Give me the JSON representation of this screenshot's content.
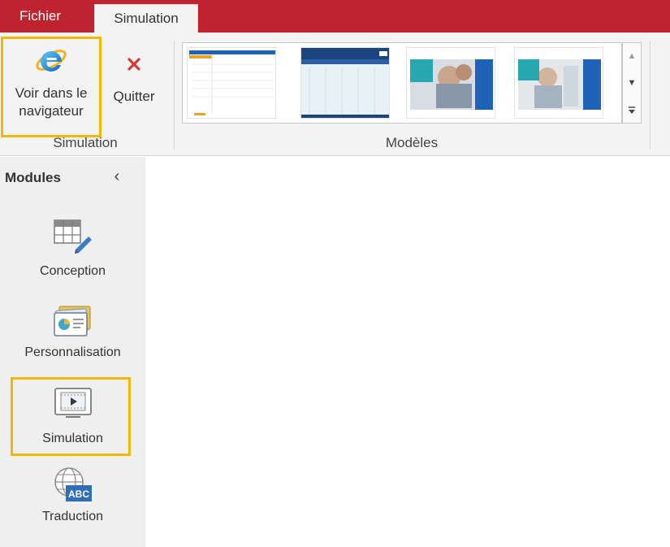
{
  "tabs": [
    {
      "label": "Fichier",
      "active": false
    },
    {
      "label": "Simulation",
      "active": true
    }
  ],
  "ribbon": {
    "simulation_group": {
      "label": "Simulation",
      "buttons": [
        {
          "label_line1": "Voir dans le",
          "label_line2": "navigateur",
          "icon": "internet-explorer-icon",
          "highlighted": true
        },
        {
          "label": "Quitter",
          "icon": "close-icon"
        }
      ]
    },
    "models_group": {
      "label": "Modèles",
      "thumbnail_count_visible": 4
    }
  },
  "sidebar": {
    "title": "Modules",
    "collapse_icon": "chevron-left-icon",
    "modules": [
      {
        "label": "Conception",
        "icon": "table-edit-icon",
        "highlighted": false
      },
      {
        "label": "Personnalisation",
        "icon": "personalization-card-icon",
        "highlighted": false
      },
      {
        "label": "Simulation",
        "icon": "video-screen-icon",
        "highlighted": true
      },
      {
        "label": "Traduction",
        "icon": "globe-abc-icon",
        "highlighted": false
      }
    ],
    "globe_icon_text": "ABC"
  },
  "colors": {
    "accent": "#bf2330",
    "highlight": "#f5b800",
    "ribbon_bg": "#f3f3f3",
    "sidebar_bg": "#efefef"
  }
}
